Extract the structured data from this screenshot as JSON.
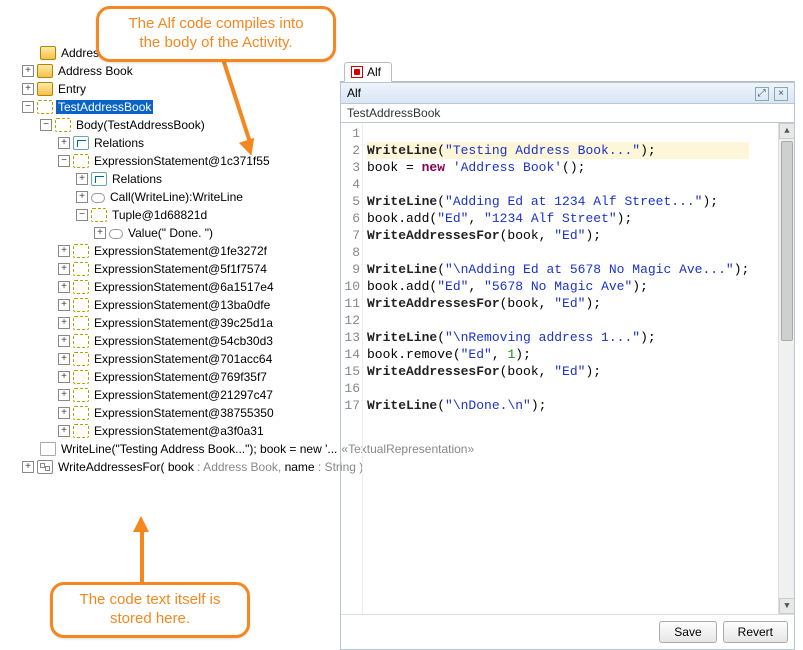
{
  "callouts": {
    "top": "The Alf code compiles into\nthe body of the Activity.",
    "bottom": "The code text itself is\nstored here."
  },
  "tree": {
    "root0": "Address Book",
    "root1": "Address Book",
    "root2": "Entry",
    "root3": "TestAddressBook",
    "body": "Body(TestAddressBook)",
    "relations": "Relations",
    "es1": "ExpressionStatement@1c371f55",
    "relations2": "Relations",
    "call": "Call(WriteLine):WriteLine",
    "tuple": "Tuple@1d68821d",
    "value": "Value(\" Done. \")",
    "es2": "ExpressionStatement@1fe3272f",
    "es3": "ExpressionStatement@5f1f7574",
    "es4": "ExpressionStatement@6a1517e4",
    "es5": "ExpressionStatement@13ba0dfe",
    "es6": "ExpressionStatement@39c25d1a",
    "es7": "ExpressionStatement@54cb30d3",
    "es8": "ExpressionStatement@701acc64",
    "es9": "ExpressionStatement@769f35f7",
    "es10": "ExpressionStatement@21297c47",
    "es11": "ExpressionStatement@38755350",
    "es12": "ExpressionStatement@a3f0a31",
    "textual_repr": "WriteLine(\"Testing Address Book...\"); book = new '... ",
    "textual_stereo": "«TextualRepresentation»",
    "write_sig_prefix": "WriteAddressesFor( ",
    "write_sig_p1": "book",
    "write_sig_t1": " : Address Book, ",
    "write_sig_p2": "name",
    "write_sig_t2": " : String )"
  },
  "editor": {
    "tab_label": "Alf",
    "title": "Alf",
    "subtitle": "TestAddressBook",
    "save": "Save",
    "revert": "Revert",
    "glyph_expand": "⤢",
    "glyph_close": "×",
    "lines": {
      "l1_fn": "WriteLine",
      "l1_a": "(",
      "l1_s": "\"Testing Address Book...\"",
      "l1_b": ");",
      "l2_a": "book = ",
      "l2_kw": "new",
      "l2_b": " ",
      "l2_s": "'Address Book'",
      "l2_c": "();",
      "l4_fn": "WriteLine",
      "l4_a": "(",
      "l4_s": "\"Adding Ed at 1234 Alf Street...\"",
      "l4_b": ");",
      "l5_a": "book.add(",
      "l5_s1": "\"Ed\"",
      "l5_b": ", ",
      "l5_s2": "\"1234 Alf Street\"",
      "l5_c": ");",
      "l6_fn": "WriteAddressesFor",
      "l6_a": "(book, ",
      "l6_s": "\"Ed\"",
      "l6_b": ");",
      "l8_fn": "WriteLine",
      "l8_a": "(",
      "l8_s": "\"\\nAdding Ed at 5678 No Magic Ave...\"",
      "l8_b": ");",
      "l9_a": "book.add(",
      "l9_s1": "\"Ed\"",
      "l9_b": ", ",
      "l9_s2": "\"5678 No Magic Ave\"",
      "l9_c": ");",
      "l10_fn": "WriteAddressesFor",
      "l10_a": "(book, ",
      "l10_s": "\"Ed\"",
      "l10_b": ");",
      "l12_fn": "WriteLine",
      "l12_a": "(",
      "l12_s": "\"\\nRemoving address 1...\"",
      "l12_b": ");",
      "l13_a": "book.remove(",
      "l13_s": "\"Ed\"",
      "l13_b": ", ",
      "l13_n": "1",
      "l13_c": ");",
      "l14_fn": "WriteAddressesFor",
      "l14_a": "(book, ",
      "l14_s": "\"Ed\"",
      "l14_b": ");",
      "l16_fn": "WriteLine",
      "l16_a": "(",
      "l16_s": "\"\\nDone.\\n\"",
      "l16_b": ");"
    },
    "line_numbers": [
      "1",
      "2",
      "3",
      "4",
      "5",
      "6",
      "7",
      "8",
      "9",
      "10",
      "11",
      "12",
      "13",
      "14",
      "15",
      "16",
      "17"
    ]
  },
  "expanders": {
    "plus": "+",
    "minus": "−"
  }
}
